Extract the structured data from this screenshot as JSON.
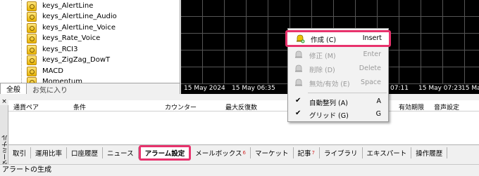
{
  "navigator": {
    "items": [
      {
        "label": "keys_AlertLine"
      },
      {
        "label": "keys_AlertLine_Audio"
      },
      {
        "label": "keys_AlertLine_Voice"
      },
      {
        "label": "keys_Rate_Voice"
      },
      {
        "label": "keys_RCI3"
      },
      {
        "label": "keys_ZigZag_DowT"
      },
      {
        "label": "MACD"
      },
      {
        "label": "Momentum"
      }
    ],
    "tabs": [
      {
        "label": "全般"
      },
      {
        "label": "お気に入り"
      }
    ]
  },
  "chart": {
    "ticks": [
      "15 May 2024",
      "15 May 06:35",
      "07:11",
      "15 May 07:23",
      "15 May"
    ]
  },
  "terminal": {
    "side_label": "ターミナル",
    "close_glyph": "×",
    "columns": [
      "通貨ペア",
      "条件",
      "カウンター",
      "最大反復数",
      "有効期限",
      "音声設定"
    ]
  },
  "context_menu": {
    "items": [
      {
        "label": "作成 (C)",
        "shortcut": "Insert"
      },
      {
        "label": "修正 (M)",
        "shortcut": "Enter"
      },
      {
        "label": "削除 (D)",
        "shortcut": "Delete"
      },
      {
        "label": "無効/有効 (E)",
        "shortcut": "Space"
      },
      {
        "label": "自動整列 (A)",
        "shortcut": "A"
      },
      {
        "label": "グリッド (G)",
        "shortcut": "G"
      }
    ],
    "check_glyph": "✔"
  },
  "bottom_tabs": [
    {
      "label": "取引",
      "badge": ""
    },
    {
      "label": "運用比率",
      "badge": ""
    },
    {
      "label": "口座履歴",
      "badge": ""
    },
    {
      "label": "ニュース",
      "badge": ""
    },
    {
      "label": "アラーム設定",
      "badge": ""
    },
    {
      "label": "メールボックス",
      "badge": "6"
    },
    {
      "label": "マーケット",
      "badge": ""
    },
    {
      "label": "記事",
      "badge": "7"
    },
    {
      "label": "ライブラリ",
      "badge": ""
    },
    {
      "label": "エキスパート",
      "badge": ""
    },
    {
      "label": "操作履歴",
      "badge": ""
    }
  ],
  "status_bar": {
    "text": "アラートの生成"
  },
  "colors": {
    "highlight_border": "#e8336d",
    "chart_bg": "#000000",
    "badge": "#d32f2f"
  }
}
